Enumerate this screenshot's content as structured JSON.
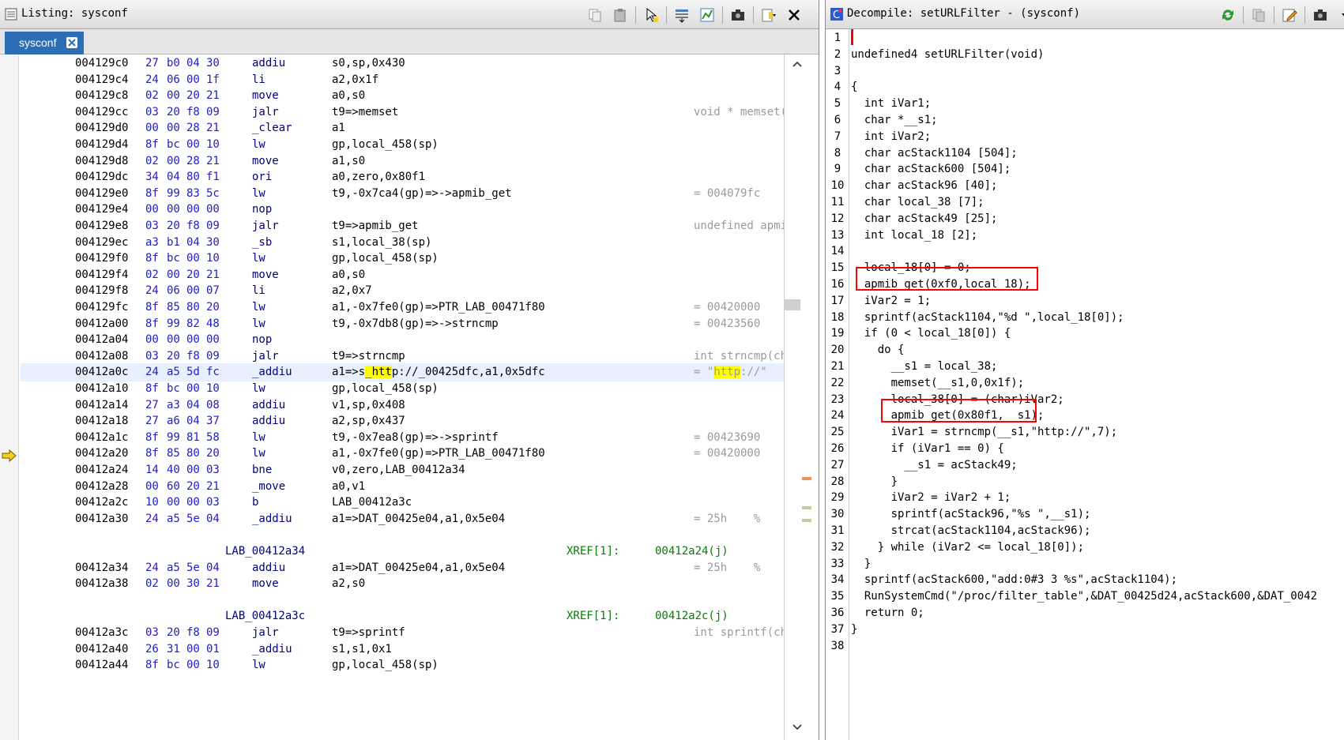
{
  "listing": {
    "title": "Listing: sysconf",
    "tab_label": "sysconf",
    "rows": [
      {
        "kind": "ins",
        "addr": "004129c0",
        "bytes": [
          "27",
          "b0",
          "04",
          "30"
        ],
        "mnem": "addiu",
        "ops": "s0,sp,0x430",
        "cmt": ""
      },
      {
        "kind": "ins",
        "addr": "004129c4",
        "bytes": [
          "24",
          "06",
          "00",
          "1f"
        ],
        "mnem": "li",
        "ops": "a2,0x1f",
        "cmt": ""
      },
      {
        "kind": "ins",
        "addr": "004129c8",
        "bytes": [
          "02",
          "00",
          "20",
          "21"
        ],
        "mnem": "move",
        "ops": "a0,s0",
        "cmt": ""
      },
      {
        "kind": "ins",
        "addr": "004129cc",
        "bytes": [
          "03",
          "20",
          "f8",
          "09"
        ],
        "mnem": "jalr",
        "ops": "t9=>memset",
        "cmt": "void * memset(voi"
      },
      {
        "kind": "ins",
        "addr": "004129d0",
        "bytes": [
          "00",
          "00",
          "28",
          "21"
        ],
        "mnem": "_clear",
        "ops": "a1",
        "cmt": ""
      },
      {
        "kind": "ins",
        "addr": "004129d4",
        "bytes": [
          "8f",
          "bc",
          "00",
          "10"
        ],
        "mnem": "lw",
        "ops": "gp,local_458(sp)",
        "cmt": ""
      },
      {
        "kind": "ins",
        "addr": "004129d8",
        "bytes": [
          "02",
          "00",
          "28",
          "21"
        ],
        "mnem": "move",
        "ops": "a1,s0",
        "cmt": ""
      },
      {
        "kind": "ins",
        "addr": "004129dc",
        "bytes": [
          "34",
          "04",
          "80",
          "f1"
        ],
        "mnem": "ori",
        "ops": "a0,zero,0x80f1",
        "cmt": ""
      },
      {
        "kind": "ins",
        "addr": "004129e0",
        "bytes": [
          "8f",
          "99",
          "83",
          "5c"
        ],
        "mnem": "lw",
        "ops": "t9,-0x7ca4(gp)=>->apmib_get",
        "cmt": "= 004079fc"
      },
      {
        "kind": "ins",
        "addr": "004129e4",
        "bytes": [
          "00",
          "00",
          "00",
          "00"
        ],
        "mnem": "nop",
        "ops": "",
        "cmt": ""
      },
      {
        "kind": "ins",
        "addr": "004129e8",
        "bytes": [
          "03",
          "20",
          "f8",
          "09"
        ],
        "mnem": "jalr",
        "ops": "t9=>apmib_get",
        "cmt": "undefined apmib_g"
      },
      {
        "kind": "ins",
        "addr": "004129ec",
        "bytes": [
          "a3",
          "b1",
          "04",
          "30"
        ],
        "mnem": "_sb",
        "ops": "s1,local_38(sp)",
        "cmt": ""
      },
      {
        "kind": "ins",
        "addr": "004129f0",
        "bytes": [
          "8f",
          "bc",
          "00",
          "10"
        ],
        "mnem": "lw",
        "ops": "gp,local_458(sp)",
        "cmt": ""
      },
      {
        "kind": "ins",
        "addr": "004129f4",
        "bytes": [
          "02",
          "00",
          "20",
          "21"
        ],
        "mnem": "move",
        "ops": "a0,s0",
        "cmt": ""
      },
      {
        "kind": "ins",
        "addr": "004129f8",
        "bytes": [
          "24",
          "06",
          "00",
          "07"
        ],
        "mnem": "li",
        "ops": "a2,0x7",
        "cmt": ""
      },
      {
        "kind": "ins",
        "addr": "004129fc",
        "bytes": [
          "8f",
          "85",
          "80",
          "20"
        ],
        "mnem": "lw",
        "ops": "a1,-0x7fe0(gp)=>PTR_LAB_00471f80",
        "cmt": "= 00420000"
      },
      {
        "kind": "ins",
        "addr": "00412a00",
        "bytes": [
          "8f",
          "99",
          "82",
          "48"
        ],
        "mnem": "lw",
        "ops": "t9,-0x7db8(gp)=>->strncmp",
        "cmt": "= 00423560"
      },
      {
        "kind": "ins",
        "addr": "00412a04",
        "bytes": [
          "00",
          "00",
          "00",
          "00"
        ],
        "mnem": "nop",
        "ops": "",
        "cmt": ""
      },
      {
        "kind": "ins",
        "addr": "00412a08",
        "bytes": [
          "03",
          "20",
          "f8",
          "09"
        ],
        "mnem": "jalr",
        "ops": "t9=>strncmp",
        "cmt": "int strncmp(char"
      },
      {
        "kind": "ins",
        "addr": "00412a0c",
        "bytes": [
          "24",
          "a5",
          "5d",
          "fc"
        ],
        "mnem": "_addiu",
        "ops": "a1=>s_http://_00425dfc,a1,0x5dfc",
        "cmt": "= \"http://\"",
        "current": true
      },
      {
        "kind": "ins",
        "addr": "00412a10",
        "bytes": [
          "8f",
          "bc",
          "00",
          "10"
        ],
        "mnem": "lw",
        "ops": "gp,local_458(sp)",
        "cmt": ""
      },
      {
        "kind": "ins",
        "addr": "00412a14",
        "bytes": [
          "27",
          "a3",
          "04",
          "08"
        ],
        "mnem": "addiu",
        "ops": "v1,sp,0x408",
        "cmt": ""
      },
      {
        "kind": "ins",
        "addr": "00412a18",
        "bytes": [
          "27",
          "a6",
          "04",
          "37"
        ],
        "mnem": "addiu",
        "ops": "a2,sp,0x437",
        "cmt": ""
      },
      {
        "kind": "ins",
        "addr": "00412a1c",
        "bytes": [
          "8f",
          "99",
          "81",
          "58"
        ],
        "mnem": "lw",
        "ops": "t9,-0x7ea8(gp)=>->sprintf",
        "cmt": "= 00423690"
      },
      {
        "kind": "ins",
        "addr": "00412a20",
        "bytes": [
          "8f",
          "85",
          "80",
          "20"
        ],
        "mnem": "lw",
        "ops": "a1,-0x7fe0(gp)=>PTR_LAB_00471f80",
        "cmt": "= 00420000"
      },
      {
        "kind": "ins",
        "addr": "00412a24",
        "bytes": [
          "14",
          "40",
          "00",
          "03"
        ],
        "mnem": "bne",
        "ops": "v0,zero,LAB_00412a34",
        "cmt": ""
      },
      {
        "kind": "ins",
        "addr": "00412a28",
        "bytes": [
          "00",
          "60",
          "20",
          "21"
        ],
        "mnem": "_move",
        "ops": "a0,v1",
        "cmt": ""
      },
      {
        "kind": "ins",
        "addr": "00412a2c",
        "bytes": [
          "10",
          "00",
          "00",
          "03"
        ],
        "mnem": "b",
        "ops": "LAB_00412a3c",
        "cmt": ""
      },
      {
        "kind": "ins",
        "addr": "00412a30",
        "bytes": [
          "24",
          "a5",
          "5e",
          "04"
        ],
        "mnem": "_addiu",
        "ops": "a1=>DAT_00425e04,a1,0x5e04",
        "cmt": "= 25h    %"
      },
      {
        "kind": "blank"
      },
      {
        "kind": "label",
        "label": "LAB_00412a34",
        "xref": "XREF[1]:",
        "xaddr": "00412a24(j)"
      },
      {
        "kind": "ins",
        "addr": "00412a34",
        "bytes": [
          "24",
          "a5",
          "5e",
          "04"
        ],
        "mnem": "addiu",
        "ops": "a1=>DAT_00425e04,a1,0x5e04",
        "cmt": "= 25h    %"
      },
      {
        "kind": "ins",
        "addr": "00412a38",
        "bytes": [
          "02",
          "00",
          "30",
          "21"
        ],
        "mnem": "move",
        "ops": "a2,s0",
        "cmt": ""
      },
      {
        "kind": "blank"
      },
      {
        "kind": "label",
        "label": "LAB_00412a3c",
        "xref": "XREF[1]:",
        "xaddr": "00412a2c(j)"
      },
      {
        "kind": "ins",
        "addr": "00412a3c",
        "bytes": [
          "03",
          "20",
          "f8",
          "09"
        ],
        "mnem": "jalr",
        "ops": "t9=>sprintf",
        "cmt": "int sprintf(char"
      },
      {
        "kind": "ins",
        "addr": "00412a40",
        "bytes": [
          "26",
          "31",
          "00",
          "01"
        ],
        "mnem": "_addiu",
        "ops": "s1,s1,0x1",
        "cmt": ""
      },
      {
        "kind": "ins",
        "addr": "00412a44",
        "bytes": [
          "8f",
          "bc",
          "00",
          "10"
        ],
        "mnem": "lw",
        "ops": "gp,local_458(sp)",
        "cmt": ""
      }
    ]
  },
  "decompile": {
    "title": "Decompile: setURLFilter -  (sysconf)",
    "lines": [
      "",
      "undefined4 setURLFilter(void)",
      "",
      "{",
      "  int iVar1;",
      "  char *__s1;",
      "  int iVar2;",
      "  char acStack1104 [504];",
      "  char acStack600 [504];",
      "  char acStack96 [40];",
      "  char local_38 [7];",
      "  char acStack49 [25];",
      "  int local_18 [2];",
      "",
      "  local_18[0] = 0;",
      "  apmib_get(0xf0,local_18);",
      "  iVar2 = 1;",
      "  sprintf(acStack1104,\"%d \",local_18[0]);",
      "  if (0 < local_18[0]) {",
      "    do {",
      "      __s1 = local_38;",
      "      memset(__s1,0,0x1f);",
      "      local_38[0] = (char)iVar2;",
      "      apmib_get(0x80f1,__s1);",
      "      iVar1 = strncmp(__s1,\"http://\",7);",
      "      if (iVar1 == 0) {",
      "        __s1 = acStack49;",
      "      }",
      "      iVar2 = iVar2 + 1;",
      "      sprintf(acStack96,\"%s \",__s1);",
      "      strcat(acStack1104,acStack96);",
      "    } while (iVar2 <= local_18[0]);",
      "  }",
      "  sprintf(acStack600,\"add:0#3 3 %s\",acStack1104);",
      "  RunSystemCmd(\"/proc/filter_table\",&DAT_00425d24,acStack600,&DAT_0042",
      "  return 0;",
      "}",
      ""
    ],
    "line_numbers": [
      "1",
      "2",
      "3",
      "4",
      "5",
      "6",
      "7",
      "8",
      "9",
      "10",
      "11",
      "12",
      "13",
      "14",
      "15",
      "16",
      "17",
      "18",
      "19",
      "20",
      "21",
      "22",
      "23",
      "24",
      "25",
      "26",
      "27",
      "28",
      "29",
      "30",
      "31",
      "32",
      "33",
      "34",
      "35",
      "36",
      "37",
      "38"
    ]
  },
  "colors": {
    "tab_active": "#2c6db5",
    "highlight_box": "#ff0000",
    "current_line_highlight": "#ffff00"
  }
}
